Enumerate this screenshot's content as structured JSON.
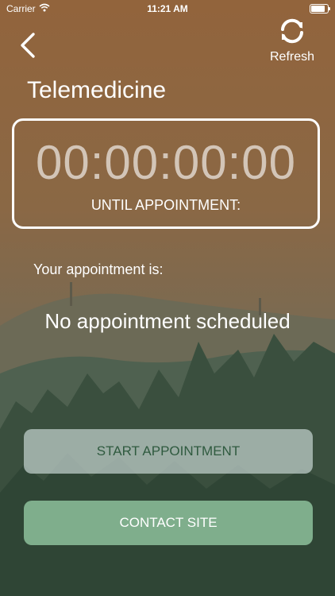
{
  "status_bar": {
    "carrier": "Carrier",
    "time": "11:21 AM",
    "battery_level": 0.95
  },
  "nav": {
    "back_icon": "chevron-left-icon",
    "refresh_icon": "refresh-icon",
    "refresh_label": "Refresh"
  },
  "page": {
    "title": "Telemedicine"
  },
  "countdown": {
    "value": "00:00:00:00",
    "caption": "UNTIL APPOINTMENT:"
  },
  "appointment": {
    "label": "Your appointment is:",
    "value": "No appointment scheduled"
  },
  "actions": {
    "start_label": "START APPOINTMENT",
    "contact_label": "CONTACT SITE"
  },
  "colors": {
    "accent": "#7fae8c",
    "start_text": "#2f5a3f"
  }
}
